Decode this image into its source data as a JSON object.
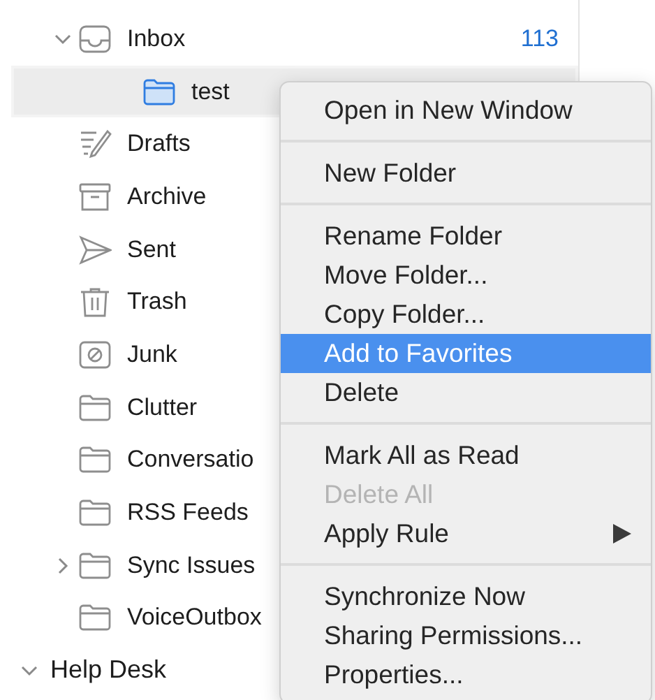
{
  "folders": [
    {
      "label": "Inbox",
      "count": "113",
      "expanded": true,
      "selected": false,
      "children": [
        {
          "label": "test",
          "selected": true
        }
      ]
    },
    {
      "label": "Drafts",
      "selected": false
    },
    {
      "label": "Archive",
      "selected": false
    },
    {
      "label": "Sent",
      "selected": false
    },
    {
      "label": "Trash",
      "selected": false
    },
    {
      "label": "Junk",
      "selected": false
    },
    {
      "label": "Clutter",
      "selected": false
    },
    {
      "label": "Conversatio",
      "selected": false
    },
    {
      "label": "RSS Feeds",
      "selected": false
    },
    {
      "label": "Sync Issues",
      "expanded": false,
      "selected": false
    },
    {
      "label": "VoiceOutbox",
      "selected": false
    }
  ],
  "account": {
    "label": "Help Desk",
    "expanded": true
  },
  "context_menu": [
    {
      "kind": "item",
      "label": "Open in New Window",
      "selected": false,
      "disabled": false
    },
    {
      "kind": "separator"
    },
    {
      "kind": "item",
      "label": "New Folder",
      "selected": false,
      "disabled": false
    },
    {
      "kind": "separator"
    },
    {
      "kind": "item",
      "label": "Rename Folder",
      "selected": false,
      "disabled": false
    },
    {
      "kind": "item",
      "label": "Move Folder...",
      "selected": false,
      "disabled": false
    },
    {
      "kind": "item",
      "label": "Copy Folder...",
      "selected": false,
      "disabled": false
    },
    {
      "kind": "item",
      "label": "Add to Favorites",
      "selected": true,
      "disabled": false
    },
    {
      "kind": "item",
      "label": "Delete",
      "selected": false,
      "disabled": false
    },
    {
      "kind": "separator"
    },
    {
      "kind": "item",
      "label": "Mark All as Read",
      "selected": false,
      "disabled": false
    },
    {
      "kind": "item",
      "label": "Delete All",
      "selected": false,
      "disabled": true
    },
    {
      "kind": "item",
      "label": "Apply Rule",
      "selected": false,
      "disabled": false,
      "submenu": true
    },
    {
      "kind": "separator"
    },
    {
      "kind": "item",
      "label": "Synchronize Now",
      "selected": false,
      "disabled": false
    },
    {
      "kind": "item",
      "label": "Sharing Permissions...",
      "selected": false,
      "disabled": false
    },
    {
      "kind": "item",
      "label": "Properties...",
      "selected": false,
      "disabled": false
    }
  ]
}
